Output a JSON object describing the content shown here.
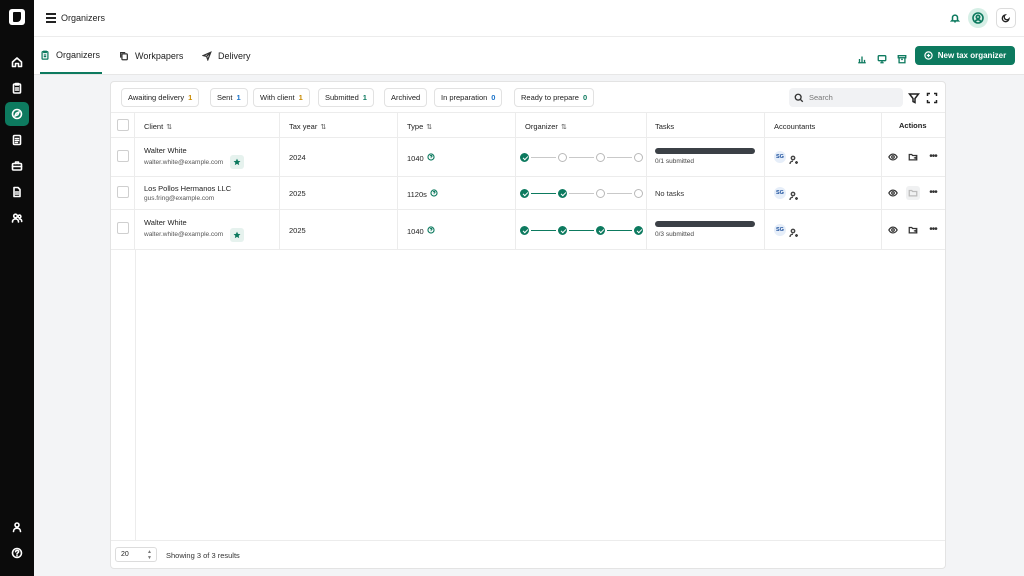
{
  "topbar": {
    "title": "Organizers"
  },
  "tabs": [
    {
      "label": "Organizers",
      "active": true
    },
    {
      "label": "Workpapers",
      "active": false
    },
    {
      "label": "Delivery",
      "active": false
    }
  ],
  "toolbar": {
    "new_button": "New tax organizer"
  },
  "filters": [
    {
      "label": "Awaiting delivery",
      "count": "1",
      "color": "amber"
    },
    {
      "label": "Sent",
      "count": "1",
      "color": "blue"
    },
    {
      "label": "With client",
      "count": "1",
      "color": "amber"
    },
    {
      "label": "Submitted",
      "count": "1",
      "color": "green"
    },
    {
      "label": "Archived",
      "count": "",
      "color": ""
    },
    {
      "label": "In preparation",
      "count": "0",
      "color": "blue"
    },
    {
      "label": "Ready to prepare",
      "count": "0",
      "color": "green"
    }
  ],
  "search": {
    "placeholder": "Search"
  },
  "table": {
    "headers": {
      "client": "Client",
      "tax_year": "Tax year",
      "type": "Type",
      "organizer": "Organizer",
      "tasks": "Tasks",
      "accountants": "Accountants",
      "actions": "Actions"
    },
    "rows": [
      {
        "name": "Walter White",
        "email": "walter.white@example.com",
        "starred": true,
        "tax_year": "2024",
        "type": "1040",
        "organizer_steps_done": 1,
        "organizer_steps_total": 4,
        "tasks_progress": 0,
        "tasks_text": "0/1 submitted",
        "accountant": "SG"
      },
      {
        "name": "Los Pollos Hermanos LLC",
        "email": "gus.fring@example.com",
        "starred": false,
        "tax_year": "2025",
        "type": "1120s",
        "organizer_steps_done": 2,
        "organizer_steps_total": 4,
        "tasks_progress": null,
        "tasks_text": "No tasks",
        "accountant": "SG"
      },
      {
        "name": "Walter White",
        "email": "walter.white@example.com",
        "starred": true,
        "tax_year": "2025",
        "type": "1040",
        "organizer_steps_done": 4,
        "organizer_steps_total": 4,
        "tasks_progress": 0,
        "tasks_text": "0/3 submitted",
        "accountant": "SG"
      }
    ]
  },
  "footer": {
    "page_size": "20",
    "showing": "Showing 3 of 3 results"
  },
  "colors": {
    "accent": "#0d7a5f",
    "sidebar": "#0b0b0b"
  }
}
